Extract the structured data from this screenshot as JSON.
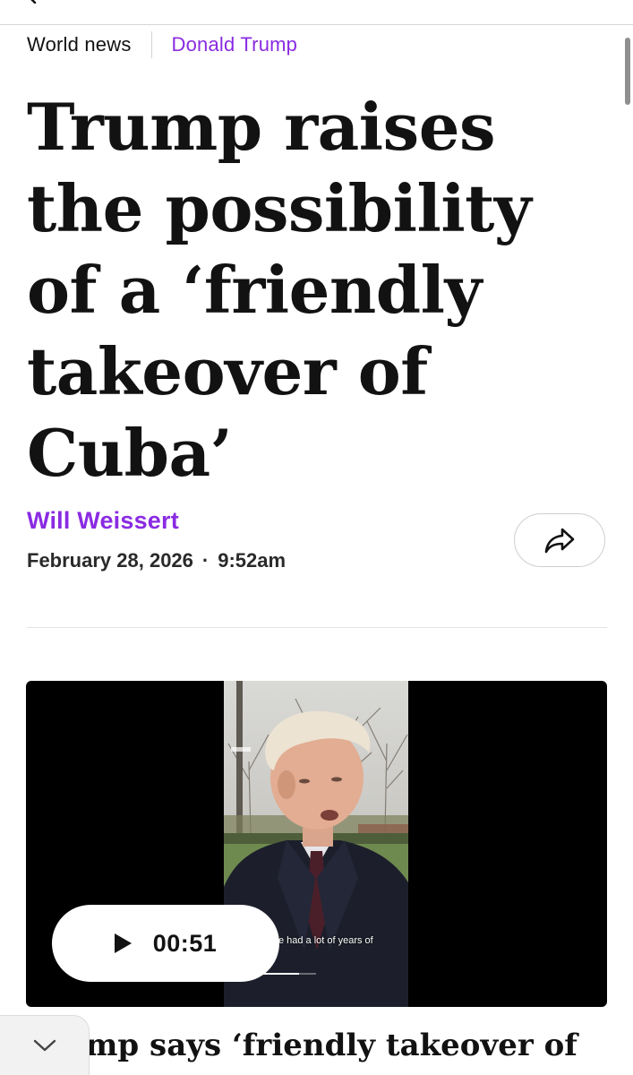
{
  "breadcrumb": {
    "section": "World news",
    "tag": "Donald Trump"
  },
  "article": {
    "headline": "Trump raises the possibility of a ‘friendly takeover of Cuba’",
    "author": "Will Weissert",
    "date": "February 28, 2026",
    "separator": "·",
    "time": "9:52am"
  },
  "video": {
    "duration": "00:51",
    "caption": "we had a lot of years of",
    "progress_fraction": 0.7
  },
  "subheadline": "Trump says ‘friendly takeover of",
  "icons": {
    "back": "chevron-left-icon",
    "share": "share-arrow-icon",
    "play": "play-icon",
    "collapse": "chevron-down-icon"
  },
  "colors": {
    "accent": "#8a2be2",
    "text": "#121212",
    "video_bg": "#000000"
  }
}
